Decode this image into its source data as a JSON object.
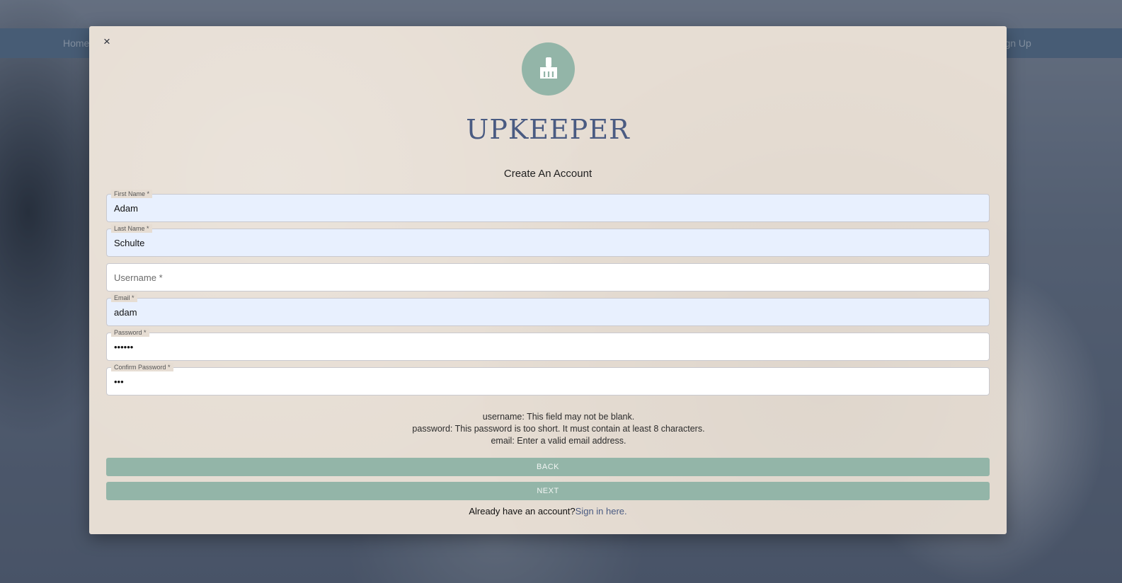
{
  "background": {
    "nav_home": "Home",
    "nav_signup": "Sign Up"
  },
  "modal": {
    "close_label": "×",
    "brand": "UPKEEPER",
    "title": "Create An Account",
    "fields": {
      "first_name": {
        "label": "First Name *",
        "value": "Adam"
      },
      "last_name": {
        "label": "Last Name *",
        "value": "Schulte"
      },
      "username": {
        "placeholder": "Username *"
      },
      "email": {
        "label": "Email *",
        "value": "adam"
      },
      "password": {
        "label": "Password *",
        "value": "••••••"
      },
      "confirm_password": {
        "label": "Confirm Password *",
        "value": "•••"
      }
    },
    "errors": [
      "username: This field may not be blank.",
      "password: This password is too short. It must contain at least 8 characters.",
      "email: Enter a valid email address."
    ],
    "back_label": "BACK",
    "next_label": "NEXT",
    "signin_prompt": "Already have an account?",
    "signin_link": "Sign in here."
  },
  "colors": {
    "accent": "#93b5a8",
    "brand": "#4a5b82",
    "modal_bg": "#e6ddd3",
    "autofill_bg": "#e8f0fe"
  },
  "icons": {
    "logo": "broom-icon",
    "close": "close-icon"
  }
}
